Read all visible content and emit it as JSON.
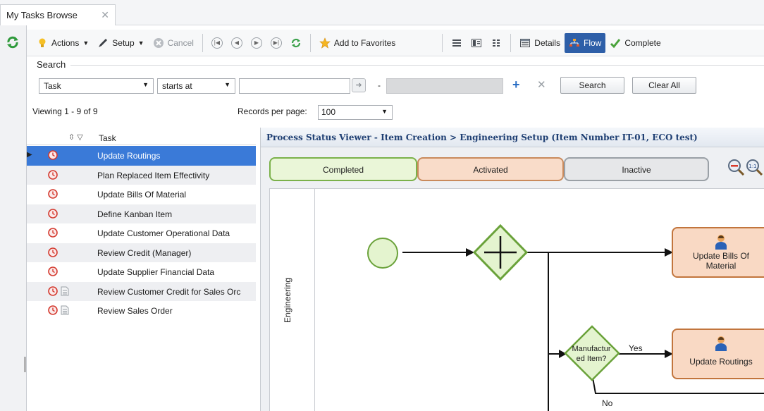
{
  "tab": {
    "title": "My Tasks Browse",
    "close": "✕"
  },
  "toolbar": {
    "actions": "Actions",
    "setup": "Setup",
    "cancel": "Cancel",
    "add_favorites": "Add to Favorites",
    "details": "Details",
    "flow": "Flow",
    "complete": "Complete"
  },
  "search": {
    "label": "Search",
    "field": "Task",
    "operator": "starts at",
    "dash": "-",
    "search_button": "Search",
    "clear_button": "Clear All"
  },
  "listing": {
    "viewing": "Viewing 1 - 9 of 9",
    "records_label": "Records per page:",
    "records_value": "100"
  },
  "grid": {
    "column": "Task",
    "rows": [
      {
        "label": "Update Routings",
        "doc": false,
        "selected": true
      },
      {
        "label": "Plan Replaced Item Effectivity",
        "doc": false
      },
      {
        "label": "Update Bills Of Material",
        "doc": false
      },
      {
        "label": "Define Kanban Item",
        "doc": false
      },
      {
        "label": "Update Customer Operational Data",
        "doc": false
      },
      {
        "label": "Review Credit (Manager)",
        "doc": false
      },
      {
        "label": "Update Supplier Financial Data",
        "doc": false
      },
      {
        "label": "Review Customer Credit for Sales Orc",
        "doc": true
      },
      {
        "label": "Review Sales Order",
        "doc": true
      }
    ]
  },
  "process": {
    "title": "Process Status Viewer - Item Creation > Engineering Setup (Item Number IT-01, ECO test)",
    "legend": {
      "completed": "Completed",
      "activated": "Activated",
      "inactive": "Inactive"
    },
    "lane": "Engineering",
    "task_bills_line1": "Update Bills Of",
    "task_bills_line2": "Material",
    "task_routings": "Update Routings",
    "decision_line1": "Manufactur",
    "decision_line2": "ed Item?",
    "yes": "Yes",
    "no": "No"
  },
  "colors": {
    "selected_row": "#3a7ad8",
    "completed_fill": "#eaf6d8",
    "completed_border": "#7bb14a",
    "activated_fill": "#f9dcc9",
    "activated_border": "#c98a5c",
    "inactive_fill": "#e6e7e9",
    "title_text": "#1f3f73"
  }
}
